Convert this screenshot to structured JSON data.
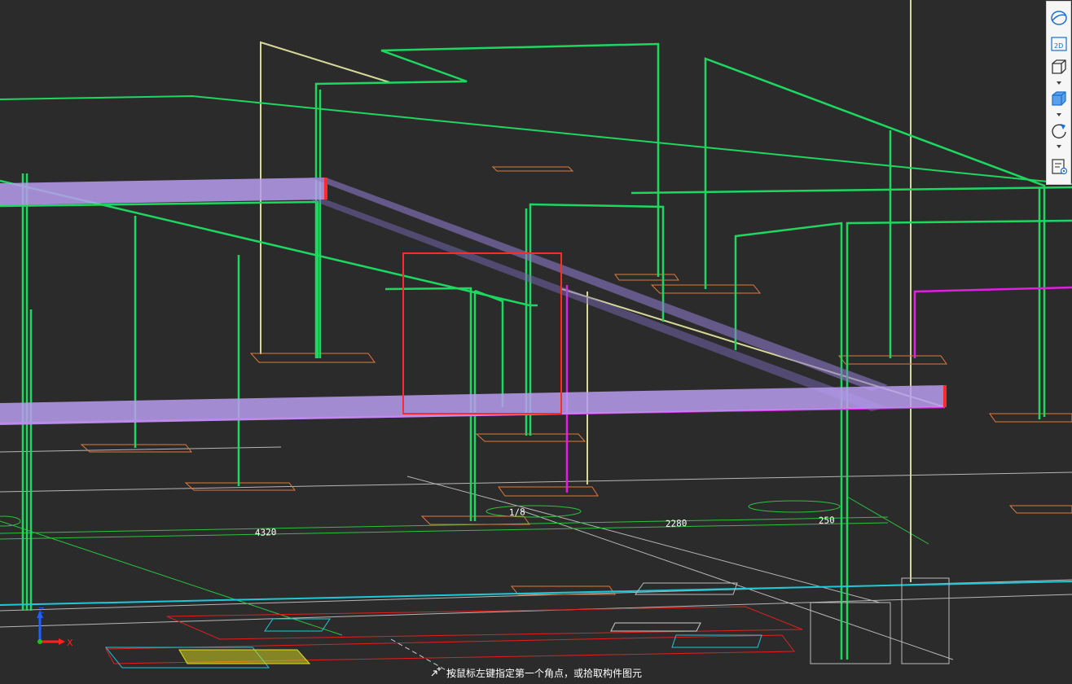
{
  "status": {
    "hint": "按鼠标左键指定第一个角点，或拾取构件图元",
    "hint_icon": "crosshair-select-icon"
  },
  "viewport": {
    "dimension_labels": [
      "4320",
      "1/8",
      "2280",
      "250"
    ],
    "axis_labels": {
      "z": "Z",
      "x": "X"
    }
  },
  "toolbar": {
    "buttons": [
      {
        "name": "orbit-sphere-icon"
      },
      {
        "name": "view-2d-icon",
        "label": "2D"
      },
      {
        "name": "view-3d-wireframe-icon"
      },
      {
        "name": "view-3d-solid-icon"
      },
      {
        "name": "rotate-icon"
      },
      {
        "name": "display-settings-icon"
      }
    ]
  },
  "colors": {
    "background": "#2b2b2b",
    "column": "#1ed760",
    "beam_fill": "#b89cf0",
    "selection_box": "#ff2a2a",
    "footing": "#e07a3a",
    "magenta_beam": "#e020e0",
    "khaki_line": "#d8d79a"
  }
}
